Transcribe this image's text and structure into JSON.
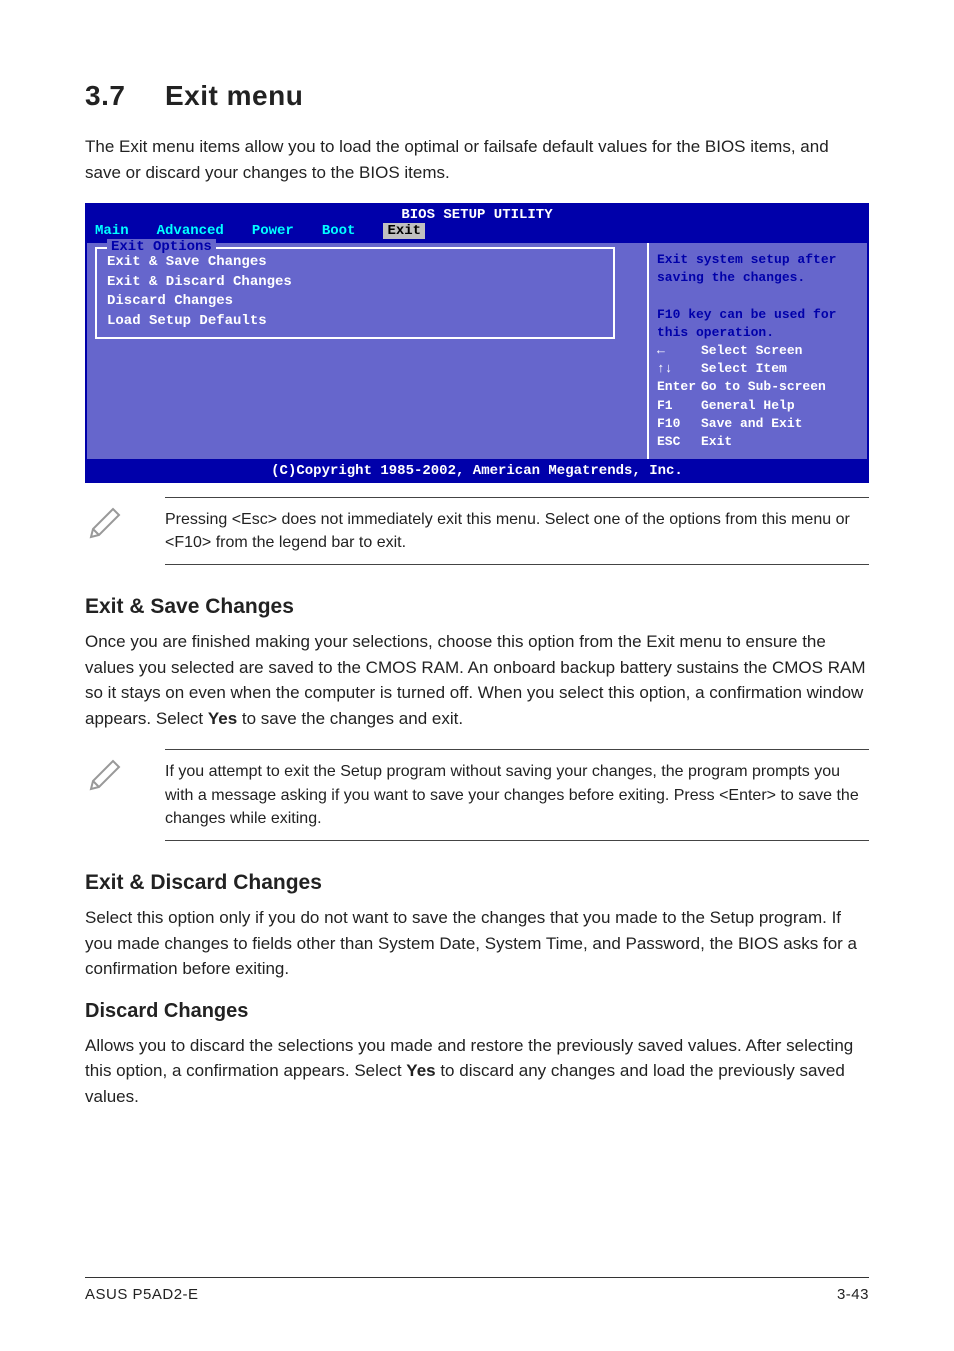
{
  "page": {
    "section_number": "3.7",
    "section_title": "Exit menu",
    "intro": "The Exit menu items allow you to load the optimal or failsafe default values for the BIOS items, and save or discard your changes to the BIOS items."
  },
  "bios": {
    "title": "BIOS SETUP UTILITY",
    "tabs": [
      "Main",
      "Advanced",
      "Power",
      "Boot",
      "Exit"
    ],
    "active_tab": "Exit",
    "frame_title": "Exit Options",
    "items": [
      "Exit & Save Changes",
      "Exit & Discard Changes",
      "Discard Changes",
      "",
      "Load Setup Defaults"
    ],
    "help_top": "Exit system setup after saving the changes.",
    "help_top2": "F10 key can be used for this operation.",
    "keys": [
      {
        "k": "←",
        "d": "Select Screen"
      },
      {
        "k": "↑↓",
        "d": "Select Item"
      },
      {
        "k": "Enter",
        "d": "Go to Sub-screen"
      },
      {
        "k": "F1",
        "d": "General Help"
      },
      {
        "k": "F10",
        "d": "Save and Exit"
      },
      {
        "k": "ESC",
        "d": "Exit"
      }
    ],
    "copyright": "(C)Copyright 1985-2002, American Megatrends, Inc."
  },
  "notes": {
    "n1": "Pressing <Esc> does not immediately exit this menu. Select one of the options from this menu or <F10> from the legend bar to exit.",
    "n2": " If you attempt to exit the Setup program without saving your changes, the program prompts you with a message asking if you want to save your changes before exiting. Press <Enter>  to save the  changes while exiting."
  },
  "sections": {
    "s1_title": "Exit & Save Changes",
    "s1_body_a": "Once you are finished making your selections, choose this option from the Exit menu to ensure the values you selected are saved to the CMOS RAM. An onboard backup battery sustains the CMOS RAM so it stays on even when the computer is turned off. When you select this option, a confirmation window appears. Select ",
    "s1_body_yes": "Yes",
    "s1_body_b": " to save the changes and exit.",
    "s2_title": "Exit & Discard Changes",
    "s2_body": "Select this option only if you do not want to save the changes that you made to the Setup program. If you made changes to fields other than System Date, System Time, and Password, the BIOS asks for a confirmation before exiting.",
    "s3_title": "Discard Changes",
    "s3_body_a": "Allows you to discard the selections you made and restore the previously saved values. After selecting this option, a confirmation appears. Select ",
    "s3_body_yes": "Yes",
    "s3_body_b": " to discard any changes and load the previously saved values."
  },
  "footer": {
    "left": "ASUS P5AD2-E",
    "right": "3-43"
  }
}
